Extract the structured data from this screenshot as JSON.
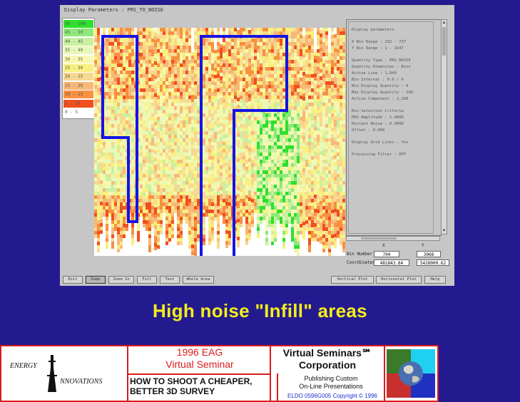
{
  "window": {
    "title": "Display Parameters : PRS_TO_NOISE"
  },
  "legend": {
    "rows": [
      {
        "label": "50 - 100",
        "color": "#2ee02e"
      },
      {
        "label": "45 - 50",
        "color": "#8ee87a"
      },
      {
        "label": "40 - 45",
        "color": "#c8f0a0"
      },
      {
        "label": "35 - 40",
        "color": "#e8f8b8"
      },
      {
        "label": "30 - 35",
        "color": "#f8f8b0"
      },
      {
        "label": "25 - 30",
        "color": "#f8f080"
      },
      {
        "label": "20 - 25",
        "color": "#f8d890"
      },
      {
        "label": "15 - 20",
        "color": "#f8b878"
      },
      {
        "label": "10 - 15",
        "color": "#f89040"
      },
      {
        "label": "5 - 10",
        "color": "#f05020"
      },
      {
        "label": "0 - 5",
        "color": "#ffffff"
      }
    ]
  },
  "info_panel": {
    "lines": [
      "Display parameters",
      "X Bin Range : 232 - 737",
      "Y Bin Range : 1 - 1647",
      "Quantity Type      : PRS_NOISE",
      "Quantity Dimension : Bins",
      "Active Line        : 1,040",
      "Bin Interval       : 0.0 / 0",
      "Min Display Quantity : 0",
      "Max Display Quantity : 100",
      "Active Component   : 2,200",
      "Bin Selection Criteria",
      "PRS Amplitude : 1.0000",
      "Percent Noise : 0.0000",
      "Offset : 0.000",
      "Display Grid Lines : Yes",
      "Processing Filter : OFF"
    ]
  },
  "coords": {
    "x_header": "X",
    "y_header": "Y",
    "bin_label": "Bin Number",
    "bin_x": "704",
    "bin_y": "3068",
    "coord_label": "Coordinates",
    "coord_x": "481843.84",
    "coord_y": "5428000.62"
  },
  "buttons": {
    "exit": "Exit",
    "dump": "Dump",
    "zoom_in": "Zoom In",
    "full": "Full",
    "text": "Text",
    "whole_area": "Whole Area",
    "vertical_plot": "Vertical Plot",
    "horizontal_plot": "Horizontal Plot",
    "help": "Help"
  },
  "caption": "High noise  \"Infill\" areas",
  "footer": {
    "logo_line1": "ENERGY",
    "logo_line2": "NNOVATIONS",
    "eag_line1": "1996 EAG",
    "eag_line2": "Virtual Seminar",
    "course_line1": "HOW TO SHOOT A CHEAPER,",
    "course_line2": "BETTER 3D SURVEY",
    "vs_line1": "Virtual Seminars℠",
    "vs_line2": "Corporation",
    "vs_sub1": "Publishing Custom",
    "vs_sub2": "On-Line Presentations",
    "copyright": "ELDO 0596G005 Copyright © 1996"
  },
  "colors": {
    "background": "#241a8f",
    "caption": "#f4ee1a",
    "outline": "#1414e6",
    "footer_border": "#d81c1c"
  }
}
